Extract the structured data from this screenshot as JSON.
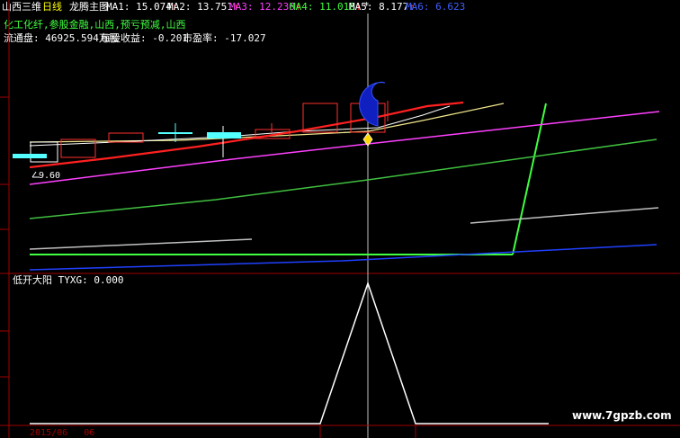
{
  "header": {
    "stock_name": "山西三维",
    "period": "日线",
    "indicator": "龙腾主图",
    "ma": [
      {
        "label": "MA1:",
        "value": "15.074",
        "color": "#ffffff"
      },
      {
        "label": "MA2:",
        "value": "13.751",
        "color": "#ffffff"
      },
      {
        "label": "MA3:",
        "value": "12.236",
        "color": "#ff40ff"
      },
      {
        "label": "MA4:",
        "value": "11.018",
        "color": "#40ff40"
      },
      {
        "label": "MA5:",
        "value": "8.177",
        "color": "#ffffff"
      },
      {
        "label": "MA6:",
        "value": "6.623",
        "color": "#4060ff"
      }
    ],
    "arrow": "↑",
    "star": "*"
  },
  "info": {
    "sectors": "化工化纤,参股金融,山西,预亏预减,山西",
    "float_label": "流通盘:",
    "float_value": "46925.594万股",
    "eps_label": "每股收益:",
    "eps_value": "-0.201",
    "pe_label": "市盈率:",
    "pe_value": "-17.027"
  },
  "main_chart": {
    "low_price_label": "9.60",
    "colors": {
      "up": "#ff3030",
      "down": "#54ffff",
      "ma1": "#ffffff",
      "ma2": "#f0e68c",
      "ma3": "#ff40ff",
      "ma4": "#40c040",
      "ma5": "#c0c0c0",
      "ma6": "#2040ff",
      "signal": "#ffd700"
    }
  },
  "sub_chart": {
    "title": "低开大阳",
    "indicator_label": "TYXG:",
    "indicator_value": "0.000",
    "values": [
      0,
      0,
      1,
      0,
      0
    ]
  },
  "footer": {
    "date": "2015/06",
    "date2": "06"
  },
  "watermark": "www.7gpzb.com"
}
